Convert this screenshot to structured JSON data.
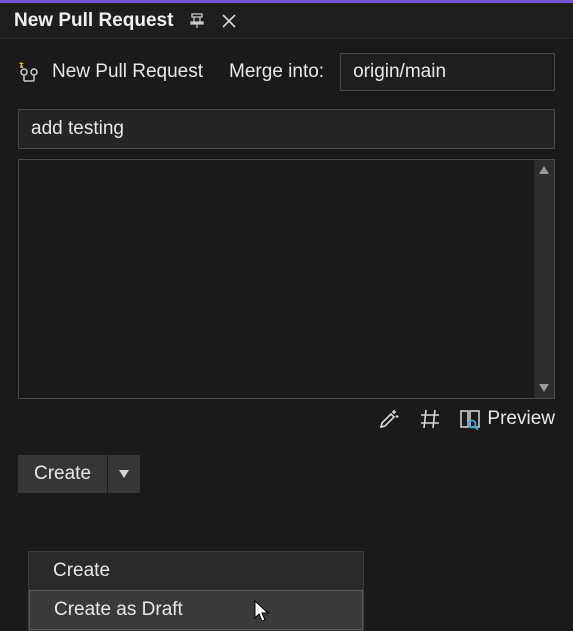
{
  "tab": {
    "title": "New Pull Request"
  },
  "toolbar": {
    "title": "New Pull Request",
    "merge_label": "Merge into:",
    "branch": "origin/main"
  },
  "pr": {
    "title": "add testing",
    "description": ""
  },
  "desc_toolbar": {
    "preview_label": "Preview"
  },
  "actions": {
    "create_label": "Create"
  },
  "menu": {
    "items": [
      {
        "label": "Create"
      },
      {
        "label": "Create as Draft"
      }
    ]
  }
}
